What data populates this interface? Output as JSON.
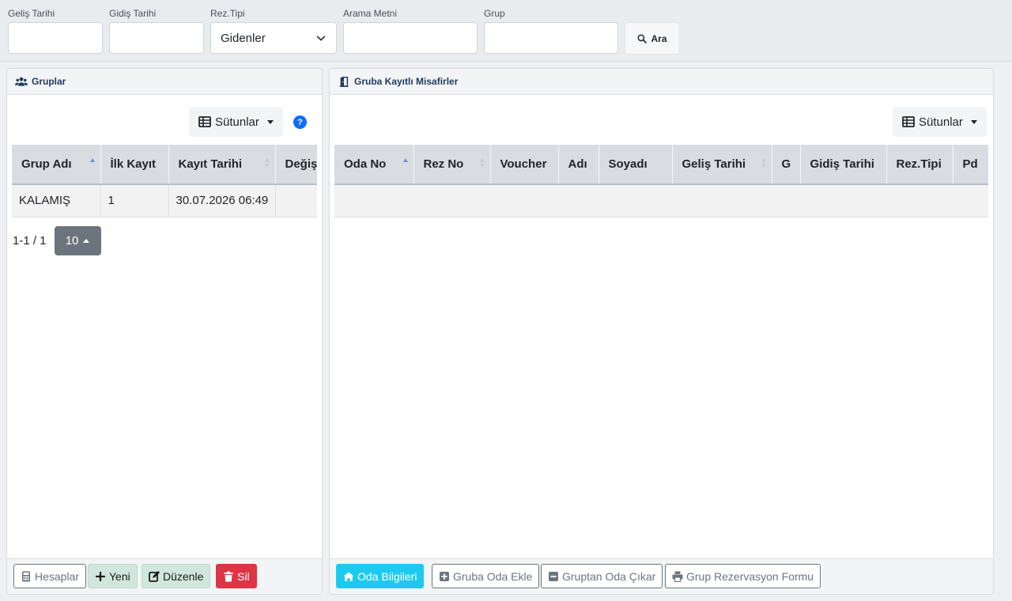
{
  "filters": {
    "gelis_label": "Geliş Tarihi",
    "gelis_value": "",
    "gidis_label": "Gidiş Tarihi",
    "gidis_value": "",
    "rez_label": "Rez.Tipi",
    "rez_value": "Gidenler",
    "arama_label": "Arama Metni",
    "arama_value": "",
    "grup_label": "Grup",
    "grup_value": "",
    "search_button": "Ara"
  },
  "groups_panel": {
    "title": "Gruplar",
    "columns_button": "Sütunlar",
    "help": "?",
    "headers": [
      "Grup Adı",
      "İlk Kayıt",
      "Kayıt Tarihi",
      "Değiş"
    ],
    "rows": [
      [
        "KALAMIŞ",
        "1",
        "30.07.2026 06:49",
        ""
      ]
    ],
    "pager_text": "1-1 / 1",
    "page_size": "10",
    "footer": {
      "hesaplar": "Hesaplar",
      "yeni": "Yeni",
      "duzenle": "Düzenle",
      "sil": "Sil"
    }
  },
  "guests_panel": {
    "title": "Gruba Kayıtlı Misafirler",
    "columns_button": "Sütunlar",
    "headers": [
      "Oda No",
      "Rez No",
      "Voucher",
      "Adı",
      "Soyadı",
      "Geliş Tarihi",
      "G",
      "Gidiş Tarihi",
      "Rez.Tipi",
      "Pd"
    ],
    "footer": {
      "oda_bilgileri": "Oda Bilgileri",
      "gruba_oda_ekle": "Gruba Oda Ekle",
      "gruptan_oda_cikar": "Gruptan Oda Çıkar",
      "grup_rez_formu": "Grup Rezervasyon Formu"
    }
  },
  "colors": {
    "accent": "#0d6efd",
    "danger": "#dc3545",
    "info": "#1ccaf0",
    "header_text": "#1f3a5a"
  }
}
